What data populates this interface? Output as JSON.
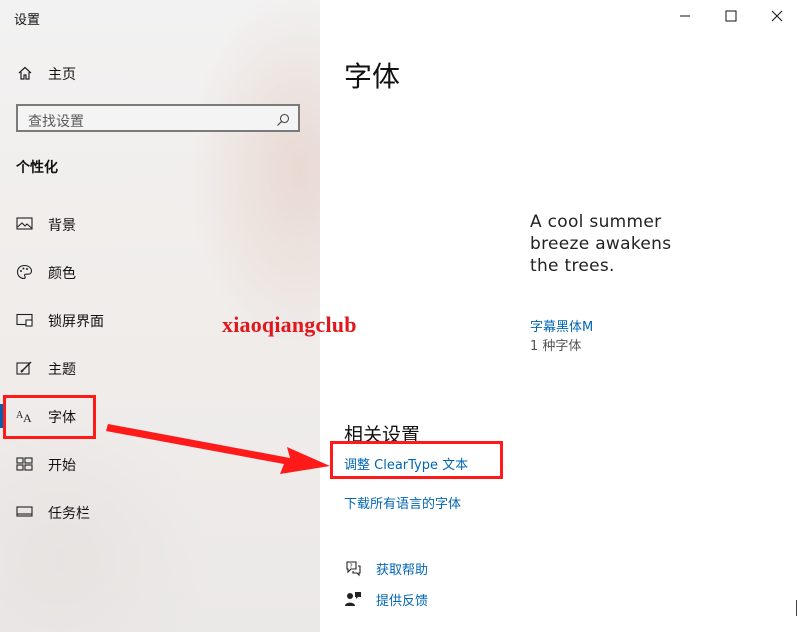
{
  "window": {
    "title": "设置",
    "controls": {
      "minimize": "minimize-icon",
      "maximize": "maximize-icon",
      "close": "close-icon"
    }
  },
  "sidebar": {
    "home_label": "主页",
    "search_placeholder": "查找设置",
    "section_title": "个性化",
    "items": [
      {
        "label": "背景",
        "icon": "picture-icon"
      },
      {
        "label": "颜色",
        "icon": "palette-icon"
      },
      {
        "label": "锁屏界面",
        "icon": "lock-screen-icon"
      },
      {
        "label": "主题",
        "icon": "theme-icon"
      },
      {
        "label": "字体",
        "icon": "font-icon",
        "selected": true
      },
      {
        "label": "开始",
        "icon": "start-icon"
      },
      {
        "label": "任务栏",
        "icon": "taskbar-icon"
      }
    ]
  },
  "main": {
    "page_title": "字体",
    "font_card": {
      "preview_line1": "A cool summer",
      "preview_line2": "breeze awakens",
      "preview_line3": "the trees.",
      "name": "字幕黑体M",
      "count": "1 种字体"
    },
    "related": {
      "title": "相关设置",
      "links": [
        "调整 ClearType 文本",
        "下载所有语言的字体"
      ]
    },
    "help": {
      "get_help": "获取帮助",
      "feedback": "提供反馈"
    }
  },
  "annotations": {
    "watermark": "xiaoqiangclub",
    "highlight_color": "#ff1a1a"
  },
  "colors": {
    "accent": "#0066b4",
    "selection_bar": "#0063b1"
  }
}
